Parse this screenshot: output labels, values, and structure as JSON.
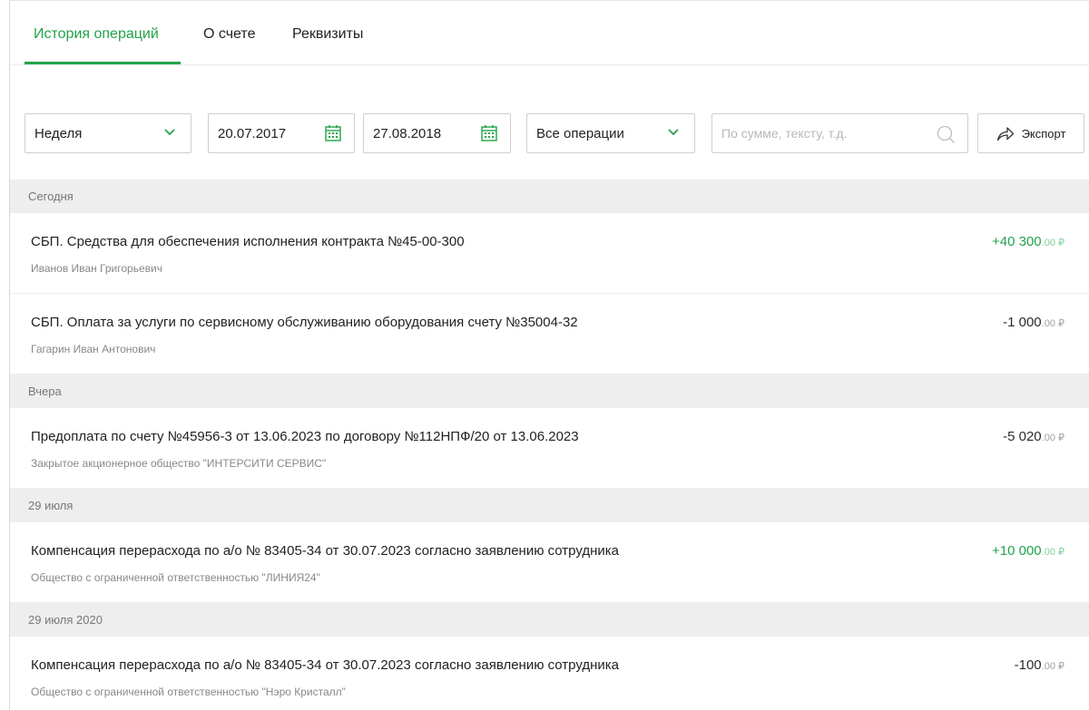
{
  "tabs": [
    {
      "label": "История операций",
      "active": true
    },
    {
      "label": "О счете",
      "active": false
    },
    {
      "label": "Реквизиты",
      "active": false
    }
  ],
  "filters": {
    "period": "Неделя",
    "date_from": "20.07.2017",
    "date_to": "27.08.2018",
    "op_type": "Все операции",
    "search_placeholder": "По сумме, тексту, т.д.",
    "export_label": "Экспорт"
  },
  "colors": {
    "accent": "#22a24b",
    "group_bg": "#eeeeee"
  },
  "groups": [
    {
      "title": "Сегодня",
      "items": [
        {
          "title": "СБП. Средства для обеспечения исполнения контракта №45-00-300",
          "sub": "Иванов Иван Григорьевич",
          "amount": "+40 300",
          "dec": ".00 ₽",
          "positive": true
        },
        {
          "title": "СБП. Оплата за услуги по сервисному обслуживанию оборудования счету №35004-32",
          "sub": "Гагарин Иван Антонович",
          "amount": "-1 000",
          "dec": ".00 ₽",
          "positive": false
        }
      ]
    },
    {
      "title": "Вчера",
      "items": [
        {
          "title": "Предоплата по счету №45956-3 от 13.06.2023 по договору №112НПФ/20 от 13.06.2023",
          "sub": "Закрытое акционерное общество \"ИНТЕРСИТИ СЕРВИС\"",
          "amount": "-5 020",
          "dec": ".00 ₽",
          "positive": false
        }
      ]
    },
    {
      "title": "29 июля",
      "items": [
        {
          "title": "Компенсация перерасхода по а/о № 83405-34 от 30.07.2023 согласно заявлению сотрудника",
          "sub": "Общество с ограниченной ответственностью \"ЛИНИЯ24\"",
          "amount": "+10 000",
          "dec": ".00 ₽",
          "positive": true
        }
      ]
    },
    {
      "title": "29 июля 2020",
      "items": [
        {
          "title": "Компенсация перерасхода по а/о № 83405-34 от 30.07.2023 согласно заявлению сотрудника",
          "sub": "Общество с ограниченной ответственностью \"Нэро Кристалл\"",
          "amount": "-100",
          "dec": ".00 ₽",
          "positive": false
        }
      ]
    }
  ]
}
